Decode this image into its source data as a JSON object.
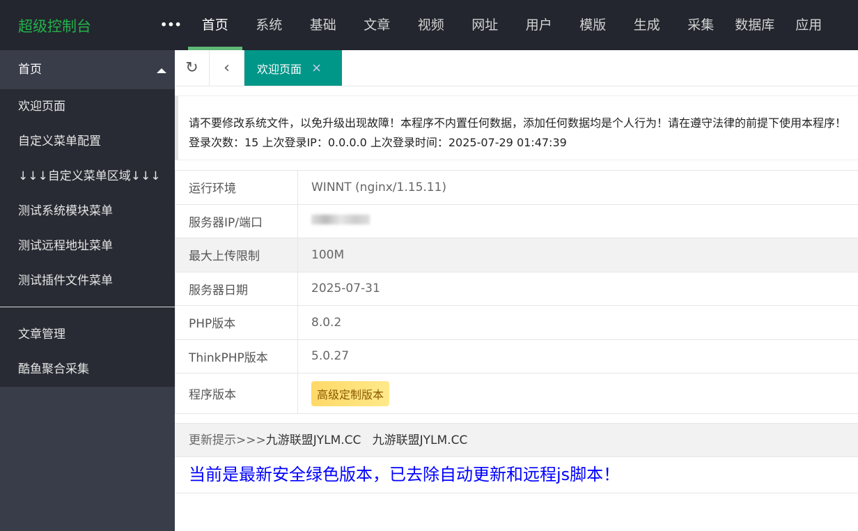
{
  "header": {
    "logo": "超级控制台",
    "more": "•••",
    "nav": [
      "首页",
      "系统",
      "基础",
      "文章",
      "视频",
      "网址",
      "用户",
      "模版",
      "生成",
      "采集",
      "数据库",
      "应用"
    ]
  },
  "sidebar": {
    "section": "首页",
    "items": [
      "欢迎页面",
      "自定义菜单配置",
      "↓↓↓自定义菜单区域↓↓↓",
      "测试系统模块菜单",
      "测试远程地址菜单",
      "测试插件文件菜单"
    ],
    "items2": [
      "文章管理",
      "酷鱼聚合采集"
    ]
  },
  "tabs": {
    "active": "欢迎页面",
    "close": "×"
  },
  "notice": {
    "line1": "请不要修改系统文件，以免升级出现故障！本程序不内置任何数据，添加任何数据均是个人行为！请在遵守法律的前提下使用本程序！",
    "line2": "登录次数：15 上次登录IP：0.0.0.0 上次登录时间：2025-07-29 01:47:39"
  },
  "info": [
    {
      "label": "运行环境",
      "value": "WINNT (nginx/1.15.11)"
    },
    {
      "label": "服务器IP/端口",
      "value": ""
    },
    {
      "label": "最大上传限制",
      "value": "100M"
    },
    {
      "label": "服务器日期",
      "value": "2025-07-31"
    },
    {
      "label": "PHP版本",
      "value": "8.0.2"
    },
    {
      "label": "ThinkPHP版本",
      "value": "5.0.27"
    },
    {
      "label": "程序版本",
      "value": "高级定制版本"
    }
  ],
  "update": {
    "prefix": "更新提示>>>",
    "links": [
      "九游联盟JYLM.CC",
      "九游联盟JYLM.CC"
    ]
  },
  "message": "当前是最新安全绿色版本，已去除自动更新和远程js脚本！"
}
